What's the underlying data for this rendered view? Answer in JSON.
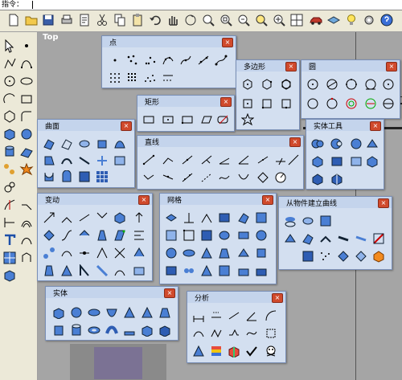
{
  "command_bar": {
    "label": "指令："
  },
  "viewport": {
    "title": "Top"
  },
  "panels": {
    "point": {
      "title": "点"
    },
    "polygon": {
      "title": "多边形"
    },
    "circle": {
      "title": "圆"
    },
    "rectangle": {
      "title": "矩形"
    },
    "surface": {
      "title": "曲面"
    },
    "line": {
      "title": "直线"
    },
    "solid_tools": {
      "title": "实体工具"
    },
    "transform": {
      "title": "变动"
    },
    "mesh": {
      "title": "网格"
    },
    "curve_from_object": {
      "title": "从物件建立曲线"
    },
    "solid": {
      "title": "实体"
    },
    "analyze": {
      "title": "分析"
    }
  },
  "close_glyph": "×"
}
